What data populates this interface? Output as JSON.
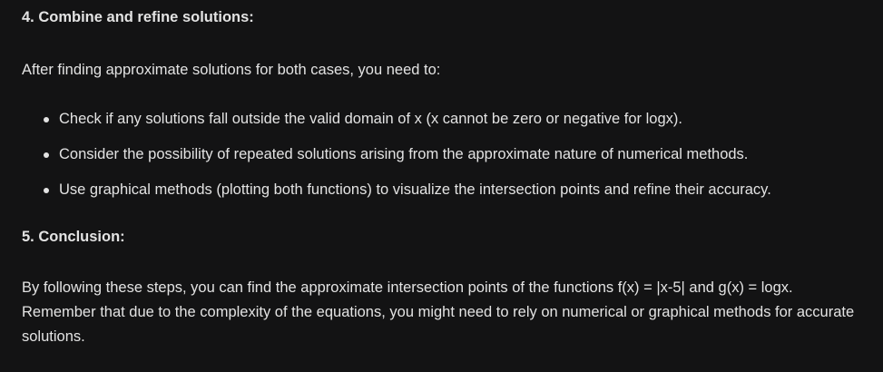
{
  "section4": {
    "heading": "4. Combine and refine solutions:",
    "intro": "After finding approximate solutions for both cases, you need to:",
    "bullets": [
      "Check if any solutions fall outside the valid domain of x (x cannot be zero or negative for logx).",
      "Consider the possibility of repeated solutions arising from the approximate nature of numerical methods.",
      "Use graphical methods (plotting both functions) to visualize the intersection points and refine their accuracy."
    ]
  },
  "section5": {
    "heading": "5. Conclusion:",
    "paragraph": "By following these steps, you can find the approximate intersection points of the functions f(x) = |x-5| and g(x) = logx. Remember that due to the complexity of the equations, you might need to rely on numerical or graphical methods for accurate solutions."
  }
}
